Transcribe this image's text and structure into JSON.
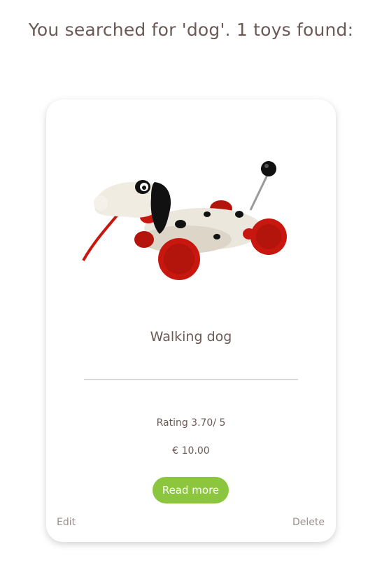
{
  "search_heading": "You searched for 'dog'. 1 toys found:",
  "colors": {
    "text": "#6b5a55",
    "button_bg": "#8cc63f",
    "button_text": "#ffffff",
    "link_muted": "#9a8f8b",
    "toy_body": "#ece7dc",
    "toy_red": "#c8170f",
    "toy_black": "#111111"
  },
  "results": [
    {
      "image_icon": "walking-dog-toy",
      "name": "Walking dog",
      "rating_text": "Rating 3.70/ 5",
      "price_text": "€ 10.00",
      "read_more_label": "Read more",
      "edit_label": "Edit",
      "delete_label": "Delete"
    }
  ]
}
